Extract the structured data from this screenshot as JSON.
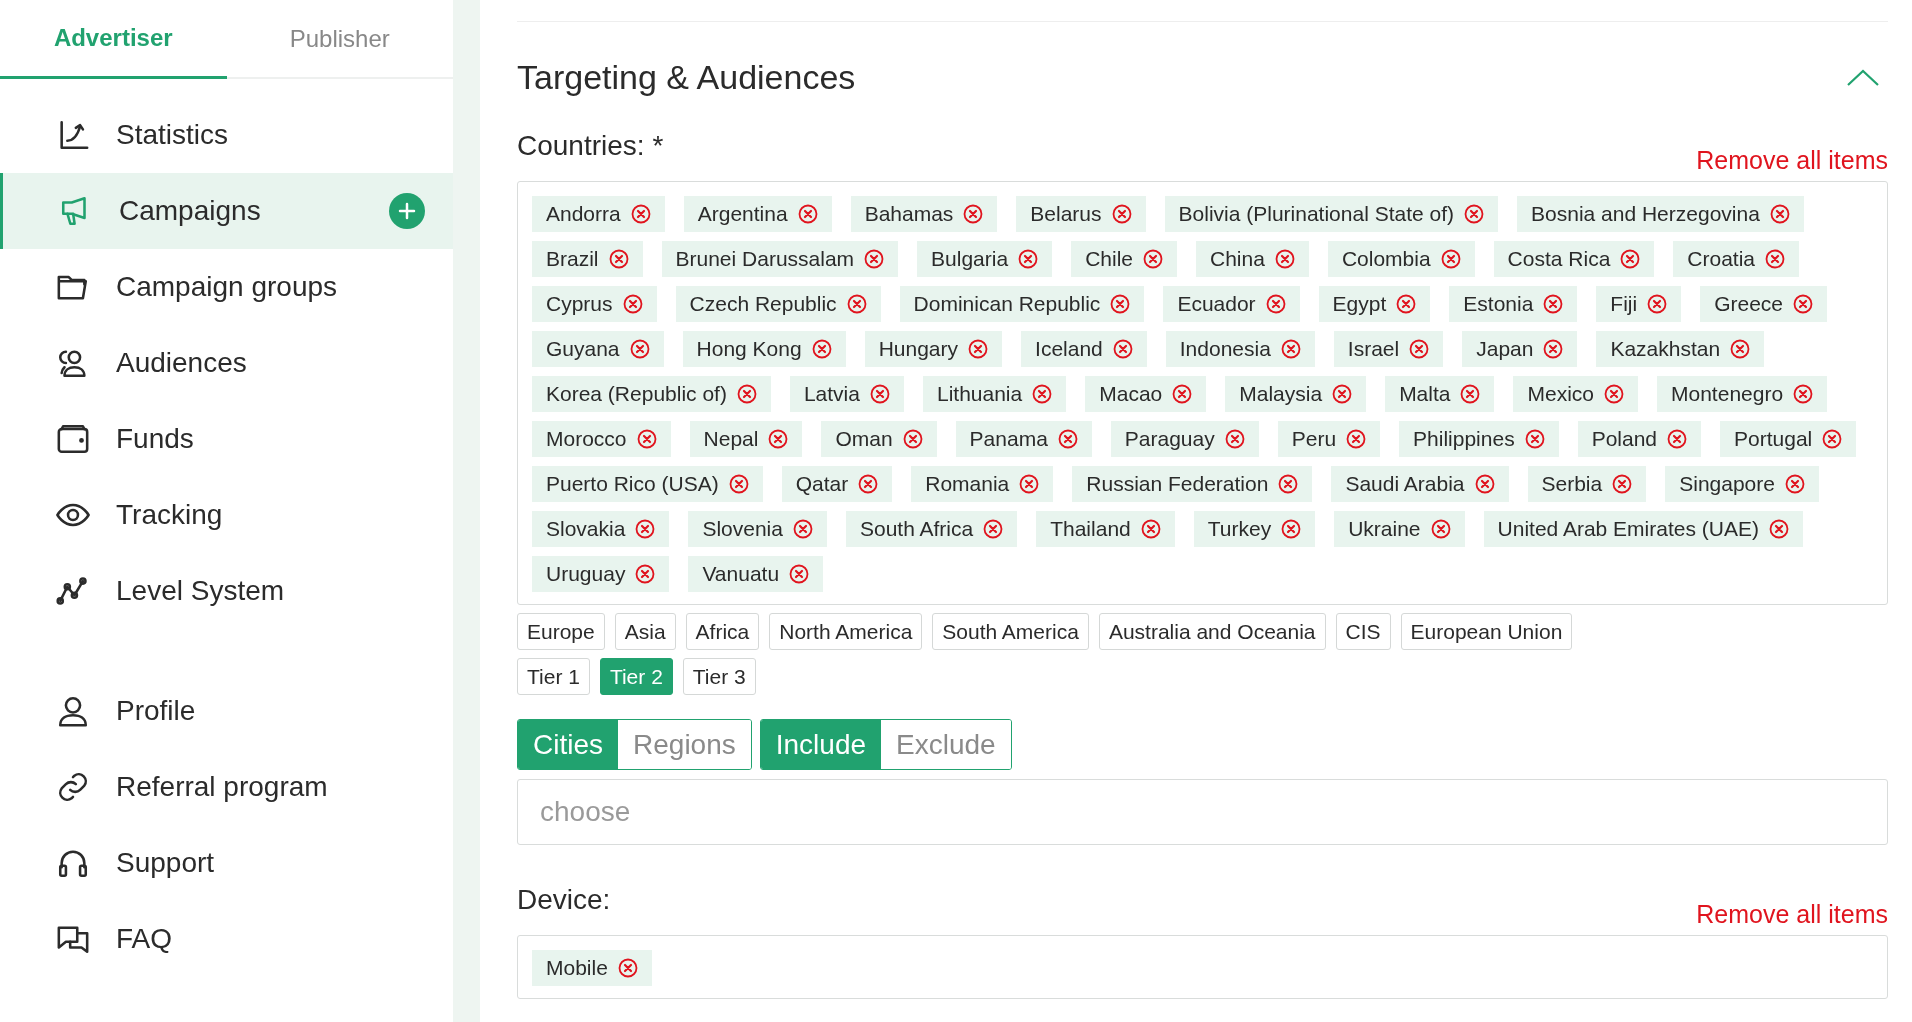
{
  "sidebar": {
    "tabs": [
      {
        "label": "Advertiser",
        "selected": true
      },
      {
        "label": "Publisher",
        "selected": false
      }
    ],
    "menu_main": [
      {
        "kind": "chart",
        "label": "Statistics",
        "selected": false,
        "add_button": false
      },
      {
        "kind": "megaphone",
        "label": "Campaigns",
        "selected": true,
        "add_button": true
      },
      {
        "kind": "folder",
        "label": "Campaign groups",
        "selected": false,
        "add_button": false
      },
      {
        "kind": "people",
        "label": "Audiences",
        "selected": false,
        "add_button": false
      },
      {
        "kind": "wallet",
        "label": "Funds",
        "selected": false,
        "add_button": false
      },
      {
        "kind": "eye",
        "label": "Tracking",
        "selected": false,
        "add_button": false
      },
      {
        "kind": "graph",
        "label": "Level System",
        "selected": false,
        "add_button": false
      }
    ],
    "menu_account": [
      {
        "kind": "person",
        "label": "Profile",
        "selected": false,
        "add_button": false
      },
      {
        "kind": "link",
        "label": "Referral program",
        "selected": false,
        "add_button": false
      },
      {
        "kind": "headset",
        "label": "Support",
        "selected": false,
        "add_button": false
      },
      {
        "kind": "chat",
        "label": "FAQ",
        "selected": false,
        "add_button": false
      }
    ]
  },
  "section": {
    "title": "Targeting & Audiences",
    "expanded": true,
    "countries": {
      "label": "Countries: *",
      "remove_all": "Remove all items",
      "tags": [
        "Andorra",
        "Argentina",
        "Bahamas",
        "Belarus",
        "Bolivia (Plurinational State of)",
        "Bosnia and Herzegovina",
        "Brazil",
        "Brunei Darussalam",
        "Bulgaria",
        "Chile",
        "China",
        "Colombia",
        "Costa Rica",
        "Croatia",
        "Cyprus",
        "Czech Republic",
        "Dominican Republic",
        "Ecuador",
        "Egypt",
        "Estonia",
        "Fiji",
        "Greece",
        "Guyana",
        "Hong Kong",
        "Hungary",
        "Iceland",
        "Indonesia",
        "Israel",
        "Japan",
        "Kazakhstan",
        "Korea (Republic of)",
        "Latvia",
        "Lithuania",
        "Macao",
        "Malaysia",
        "Malta",
        "Mexico",
        "Montenegro",
        "Morocco",
        "Nepal",
        "Oman",
        "Panama",
        "Paraguay",
        "Peru",
        "Philippines",
        "Poland",
        "Portugal",
        "Puerto Rico (USA)",
        "Qatar",
        "Romania",
        "Russian Federation",
        "Saudi Arabia",
        "Serbia",
        "Singapore",
        "Slovakia",
        "Slovenia",
        "South Africa",
        "Thailand",
        "Turkey",
        "Ukraine",
        "United Arab Emirates (UAE)",
        "Uruguay",
        "Vanuatu"
      ],
      "region_presets": [
        {
          "label": "Europe",
          "selected": false
        },
        {
          "label": "Asia",
          "selected": false
        },
        {
          "label": "Africa",
          "selected": false
        },
        {
          "label": "North America",
          "selected": false
        },
        {
          "label": "South America",
          "selected": false
        },
        {
          "label": "Australia and Oceania",
          "selected": false
        },
        {
          "label": "CIS",
          "selected": false
        },
        {
          "label": "European Union",
          "selected": false
        }
      ],
      "tier_presets": [
        {
          "label": "Tier 1",
          "selected": false
        },
        {
          "label": "Tier 2",
          "selected": true
        },
        {
          "label": "Tier 3",
          "selected": false
        }
      ]
    },
    "location_type": [
      {
        "label": "Cities",
        "selected": true
      },
      {
        "label": "Regions",
        "selected": false
      }
    ],
    "location_mode": [
      {
        "label": "Include",
        "selected": true
      },
      {
        "label": "Exclude",
        "selected": false
      }
    ],
    "location_search": {
      "placeholder": "choose"
    },
    "device": {
      "label": "Device:",
      "remove_all": "Remove all items",
      "tags": [
        "Mobile"
      ]
    }
  }
}
